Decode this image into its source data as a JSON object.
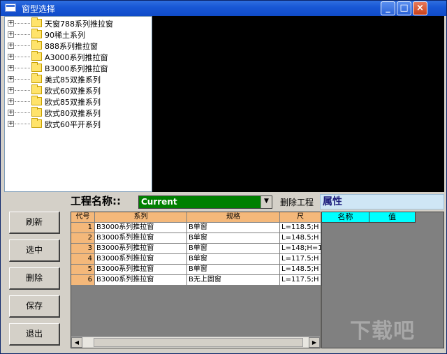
{
  "window": {
    "title": "窗型选择"
  },
  "tree": {
    "items": [
      {
        "label": "天窗788系列推拉窗"
      },
      {
        "label": "90稀土系列"
      },
      {
        "label": "888系列推拉窗"
      },
      {
        "label": "A3000系列推拉窗"
      },
      {
        "label": "B3000系列推拉窗"
      },
      {
        "label": "美式85双推系列"
      },
      {
        "label": "欧式60双推系列"
      },
      {
        "label": "欧式85双推系列"
      },
      {
        "label": "欧式80双推系列"
      },
      {
        "label": "欧式60平开系列"
      }
    ],
    "expander_glyph": "+"
  },
  "buttons": {
    "refresh": "刷新",
    "select": "选中",
    "delete": "删除",
    "save": "保存",
    "exit": "退出"
  },
  "project": {
    "label": "工程名称::",
    "current_value": "Current",
    "delete_label": "删除工程"
  },
  "grid": {
    "columns": [
      "代号",
      "系列",
      "规格",
      "尺"
    ],
    "rows": [
      {
        "num": "1",
        "series": "B3000系列推拉窗",
        "spec": "B单窗",
        "size": "L=118.5;H"
      },
      {
        "num": "2",
        "series": "B3000系列推拉窗",
        "spec": "B单窗",
        "size": "L=148.5;H"
      },
      {
        "num": "3",
        "series": "B3000系列推拉窗",
        "spec": "B单窗",
        "size": "L=148;H=1"
      },
      {
        "num": "4",
        "series": "B3000系列推拉窗",
        "spec": "B单窗",
        "size": "L=117.5;H"
      },
      {
        "num": "5",
        "series": "B3000系列推拉窗",
        "spec": "B单窗",
        "size": "L=148.5;H"
      },
      {
        "num": "6",
        "series": "B3000系列推拉窗",
        "spec": "B无上固窗",
        "size": "L=117.5;H"
      }
    ]
  },
  "properties": {
    "title": "属性",
    "columns": [
      "名称",
      "值"
    ]
  },
  "scroll": {
    "left_glyph": "◀",
    "right_glyph": "▶"
  },
  "watermark": "下载吧",
  "colors": {
    "header_orange": "#f4b87a",
    "combo_green": "#008000",
    "prop_header_cyan": "#00ffff",
    "titlebar_blue": "#0f4bc8"
  }
}
